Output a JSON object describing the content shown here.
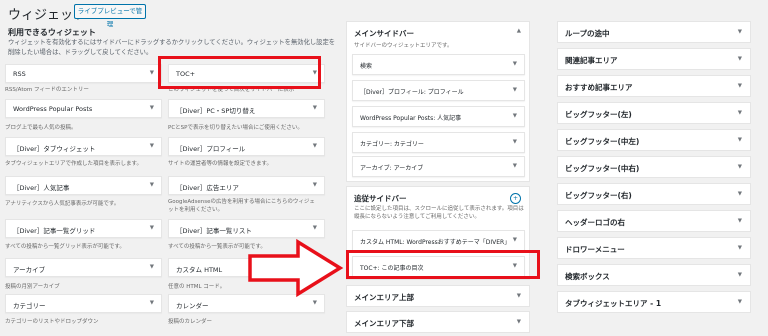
{
  "header": {
    "title": "ウィジェット",
    "live_preview_button": "ライブプレビューで管理"
  },
  "available": {
    "title": "利用できるウィジェット",
    "description": "ウィジェットを有効化するにはサイドバーにドラッグするかクリックしてください。ウィジェットを無効化し設定を削除したい場合は、ドラッグして戻してください。",
    "widgets": [
      {
        "label": "RSS",
        "desc": "RSS/Atom フィードのエントリー"
      },
      {
        "label": "TOC+",
        "desc": "このウィジェットを使って目次をサイドバーに表示"
      },
      {
        "label": "WordPress Popular Posts",
        "desc": "ブログ上で最も人気の投稿。"
      },
      {
        "label": "［Diver］PC・SP切り替え",
        "desc": "PCとSPで表示を切り替えたい場合にご使用ください。"
      },
      {
        "label": "［Diver］タブウィジェット",
        "desc": "タブウィジェットエリアで作成した項目を表示します。"
      },
      {
        "label": "［Diver］プロフィール",
        "desc": "サイトの運営者等の情報を設定できます。"
      },
      {
        "label": "［Diver］人気記事",
        "desc": "アナリティクスから人気記事表示が可能です。"
      },
      {
        "label": "［Diver］広告エリア",
        "desc": "GoogleAdsenseの広告を利用する場合にこちらのウィジェットを利用ください。"
      },
      {
        "label": "［Diver］記事一覧グリッド",
        "desc": "すべての投稿から一覧グリッド表示が可能です。"
      },
      {
        "label": "［Diver］記事一覧リスト",
        "desc": "すべての投稿から一覧表示が可能です。"
      },
      {
        "label": "アーカイブ",
        "desc": "投稿の月別アーカイブ"
      },
      {
        "label": "カスタム HTML",
        "desc": "任意の HTML コード。"
      },
      {
        "label": "カテゴリー",
        "desc": "カテゴリーのリストやドロップダウン"
      },
      {
        "label": "カレンダー",
        "desc": "投稿のカレンダー"
      }
    ]
  },
  "main_sidebar": {
    "title": "メインサイドバー",
    "description": "サイドバーのウィジェットエリアです。",
    "widgets": [
      "検索",
      "［Diver］プロフィール: プロフィール",
      "WordPress Popular Posts: 人気記事",
      "カテゴリー: カテゴリー",
      "アーカイブ: アーカイブ"
    ]
  },
  "follow_sidebar": {
    "title": "追従サイドバー",
    "description": "ここに設定した項目は、スクロールに追従して表示されます。項目は縦長にならないよう注意してご利用してください。",
    "widgets": [
      "カスタム HTML: WordPressおすすめテーマ「DIVER」",
      "TOC+: この記事の目次"
    ]
  },
  "middle_collapsed": [
    "メインエリア上部",
    "メインエリア下部"
  ],
  "right_collapsed": [
    "ループの途中",
    "関連記事エリア",
    "おすすめ記事エリア",
    "ビッグフッター(左)",
    "ビッグフッター(中左)",
    "ビッグフッター(中右)",
    "ビッグフッター(右)",
    "ヘッダーロゴの右",
    "ドロワーメニュー",
    "検索ボックス",
    "タブウィジェットエリア - 1"
  ],
  "colors": {
    "highlight": "#e8101a",
    "accent": "#0073aa"
  }
}
